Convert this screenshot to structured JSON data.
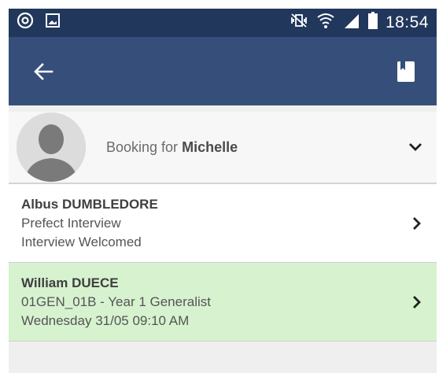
{
  "status_bar": {
    "time": "18:54",
    "icons": [
      "alarm-icon",
      "image-icon",
      "mute-vibrate-icon",
      "wifi-icon",
      "signal-icon",
      "battery-icon"
    ]
  },
  "app_bar": {
    "back_icon": "arrow-left-icon",
    "action_icon": "bookmark-icon",
    "color": "#354f7a"
  },
  "booking": {
    "prefix": "Booking for",
    "name": "Michelle"
  },
  "items": [
    {
      "name": "Albus DUMBLEDORE",
      "line1": "Prefect Interview",
      "line2": "Interview Welcomed",
      "highlight": false
    },
    {
      "name": "William DUECE",
      "line1": "01GEN_01B - Year 1 Generalist",
      "line2": "Wednesday 31/05 09:10 AM",
      "highlight": true,
      "highlight_color": "#d7f2cf"
    }
  ]
}
